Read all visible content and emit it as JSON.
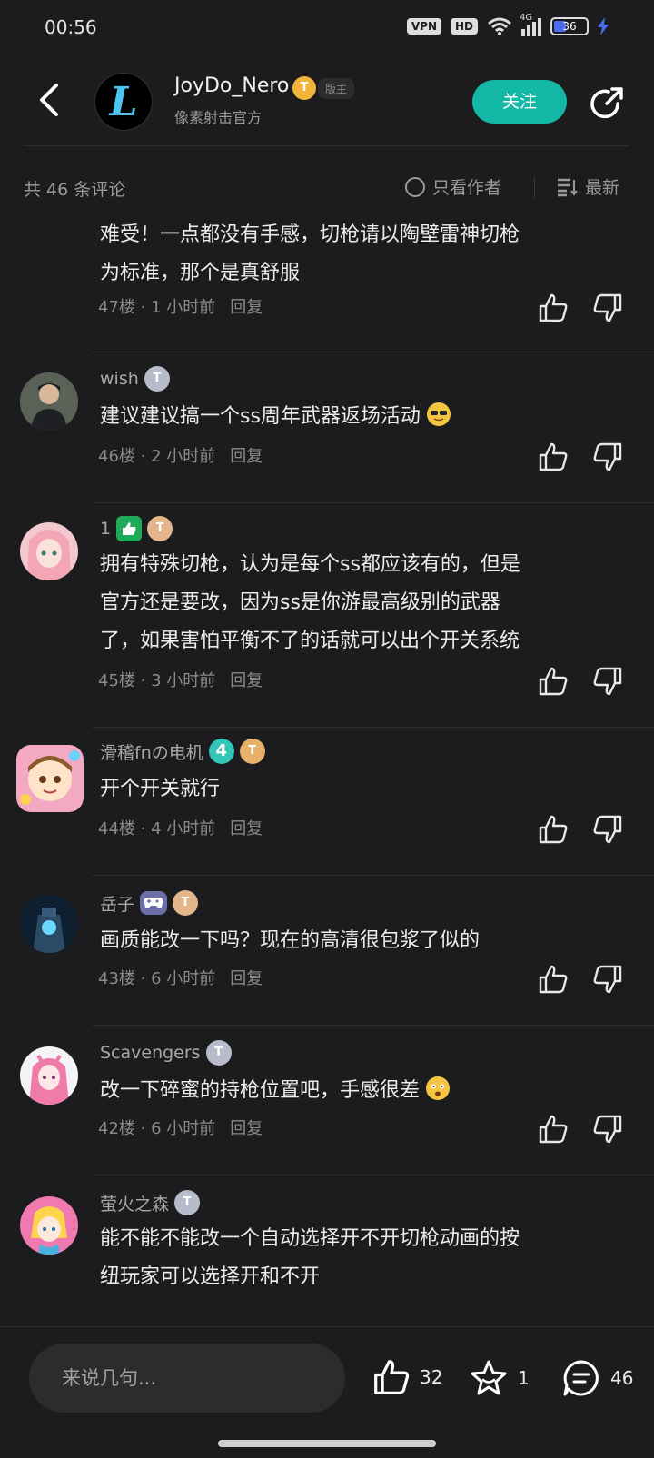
{
  "status_bar": {
    "time": "00:56",
    "vpn": "VPN",
    "hd": "HD",
    "signal": "4G",
    "battery": "36"
  },
  "header": {
    "author_name": "JoyDo_Nero",
    "author_subtitle": "像素射击官方",
    "level_badge": "T",
    "mod_tag": "版主",
    "avatar_letter": "L",
    "follow_label": "关注"
  },
  "filter": {
    "count_label": "共 46 条评论",
    "only_author_label": "只看作者",
    "sort_label": "最新"
  },
  "comments": [
    {
      "name": "",
      "badge": "",
      "text_lines": [
        "难受！一点都没有手感，切枪请以陶壁雷神切枪",
        "为标准，那个是真舒服"
      ],
      "floor": "47楼",
      "time": "1 小时前",
      "reply": "回复"
    },
    {
      "name": "wish",
      "badge": "T",
      "text_lines": [
        "建议建议搞一个ss周年武器返场活动"
      ],
      "floor": "46楼",
      "time": "2 小时前",
      "reply": "回复"
    },
    {
      "name": "1",
      "badge": "T",
      "text_lines": [
        "拥有特殊切枪，认为是每个ss都应该有的，但是",
        "官方还是要改，因为ss是你游最高级别的武器",
        "了，如果害怕平衡不了的话就可以出个开关系统"
      ],
      "floor": "45楼",
      "time": "3 小时前",
      "reply": "回复"
    },
    {
      "name": "滑稽fnの电机",
      "badge": "T",
      "badge_extra": "4",
      "text_lines": [
        "开个开关就行"
      ],
      "floor": "44楼",
      "time": "4 小时前",
      "reply": "回复"
    },
    {
      "name": "岳子",
      "badge": "T",
      "text_lines": [
        "画质能改一下吗？现在的高清很包浆了似的"
      ],
      "floor": "43楼",
      "time": "6 小时前",
      "reply": "回复"
    },
    {
      "name": "Scavengers",
      "badge": "T",
      "text_lines": [
        "改一下碎蜜的持枪位置吧，手感很差"
      ],
      "floor": "42楼",
      "time": "6 小时前",
      "reply": "回复"
    },
    {
      "name": "萤火之森",
      "badge": "T",
      "text_lines": [
        "能不能不能改一个自动选择开不开切枪动画的按",
        "纽玩家可以选择开和不开"
      ],
      "floor": "",
      "time": "",
      "reply": ""
    }
  ],
  "bottom_bar": {
    "input_placeholder": "来说几句...",
    "like_count": "32",
    "favorite_count": "1",
    "comment_count": "46"
  },
  "colors": {
    "background": "#1c1c1e",
    "accent": "#14b8a6",
    "text_primary": "#ececec",
    "text_secondary": "#8a8a8a"
  },
  "icons": [
    "back-arrow-icon",
    "share-icon",
    "radio-icon",
    "sort-lines-icon",
    "thumb-up-icon",
    "thumb-down-icon",
    "star-icon",
    "comment-bubble-icon",
    "wifi-icon",
    "signal-icon",
    "battery-icon",
    "bolt-icon"
  ]
}
